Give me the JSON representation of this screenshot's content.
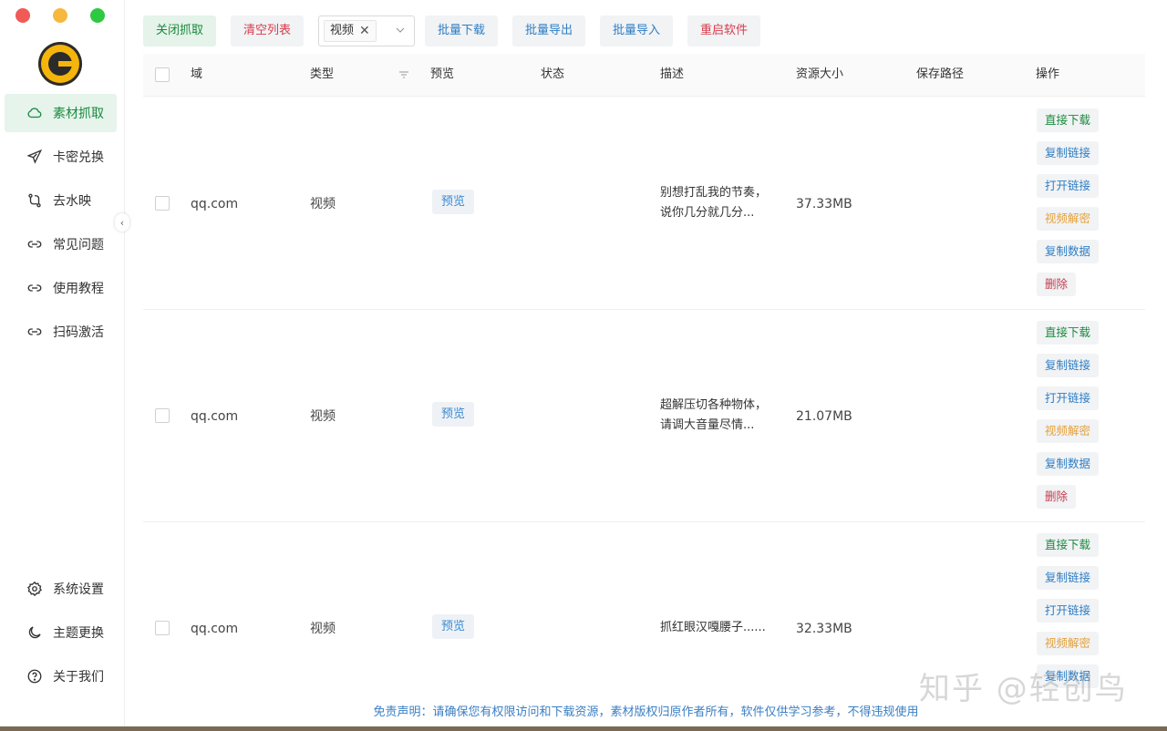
{
  "sidebar": {
    "items": [
      {
        "label": "素材抓取",
        "icon": "cloud-icon",
        "active": true
      },
      {
        "label": "卡密兑换",
        "icon": "send-icon"
      },
      {
        "label": "去水映",
        "icon": "branch-icon"
      },
      {
        "label": "常见问题",
        "icon": "link-icon"
      },
      {
        "label": "使用教程",
        "icon": "link-icon"
      },
      {
        "label": "扫码激活",
        "icon": "link-icon"
      }
    ],
    "bottom_items": [
      {
        "label": "系统设置",
        "icon": "gear-icon"
      },
      {
        "label": "主题更换",
        "icon": "moon-icon"
      },
      {
        "label": "关于我们",
        "icon": "help-icon"
      }
    ]
  },
  "toolbar": {
    "close_capture": "关闭抓取",
    "clear_list": "清空列表",
    "filter_tag": "视频",
    "batch_download": "批量下载",
    "batch_export": "批量导出",
    "batch_import": "批量导入",
    "restart": "重启软件"
  },
  "table": {
    "headers": {
      "domain": "域",
      "type": "类型",
      "preview": "预览",
      "status": "状态",
      "description": "描述",
      "size": "资源大小",
      "path": "保存路径",
      "actions": "操作"
    },
    "rows": [
      {
        "domain": "qq.com",
        "type": "视频",
        "preview": "预览",
        "desc_line1": "别想打乱我的节奏，",
        "desc_line2": "说你几分就几分...",
        "size": "37.33MB"
      },
      {
        "domain": "qq.com",
        "type": "视频",
        "preview": "预览",
        "desc_line1": "超解压切各种物体，",
        "desc_line2": "请调大音量尽情...",
        "size": "21.07MB"
      },
      {
        "domain": "qq.com",
        "type": "视频",
        "preview": "预览",
        "desc_line1": "抓红眼汉嘎腰子......",
        "desc_line2": "",
        "size": "32.33MB"
      }
    ],
    "actions": {
      "download": "直接下载",
      "copy_link": "复制链接",
      "open_link": "打开链接",
      "decrypt": "视频解密",
      "copy_data": "复制数据",
      "delete": "删除"
    }
  },
  "footer": {
    "disclaimer": "免责声明：请确保您有权限访问和下载资源，素材版权归原作者所有，软件仅供学习参考，不得违规使用"
  },
  "watermark": "知乎 @轻创鸟",
  "colors": {
    "accent_green": "#1b8a3d",
    "accent_blue": "#2f7ec5",
    "accent_red": "#d93b4a",
    "accent_orange": "#e5a13a"
  }
}
